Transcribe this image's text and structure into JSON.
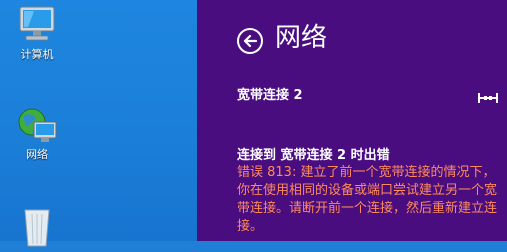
{
  "desktop": {
    "icons": [
      {
        "label": "计算机",
        "icon": "computer-icon"
      },
      {
        "label": "网络",
        "icon": "network-icon"
      },
      {
        "label": "",
        "icon": "recycle-bin-icon"
      }
    ]
  },
  "charm": {
    "title": "网络",
    "back_icon": "back-arrow-icon",
    "connection": {
      "name": "宽带连接 2",
      "icon": "broadband-connection-icon"
    },
    "error": {
      "title": "连接到 宽带连接 2 时出错",
      "message": "错误 813: 建立了前一个宽带连接的情况下，你在使用相同的设备或端口尝试建立另一个宽带连接。请断开前一个连接，然后重新建立连接。"
    },
    "colors": {
      "background": "#4a0d80",
      "error_text": "#ff8a5c",
      "desktop": "#1e86e0"
    }
  }
}
